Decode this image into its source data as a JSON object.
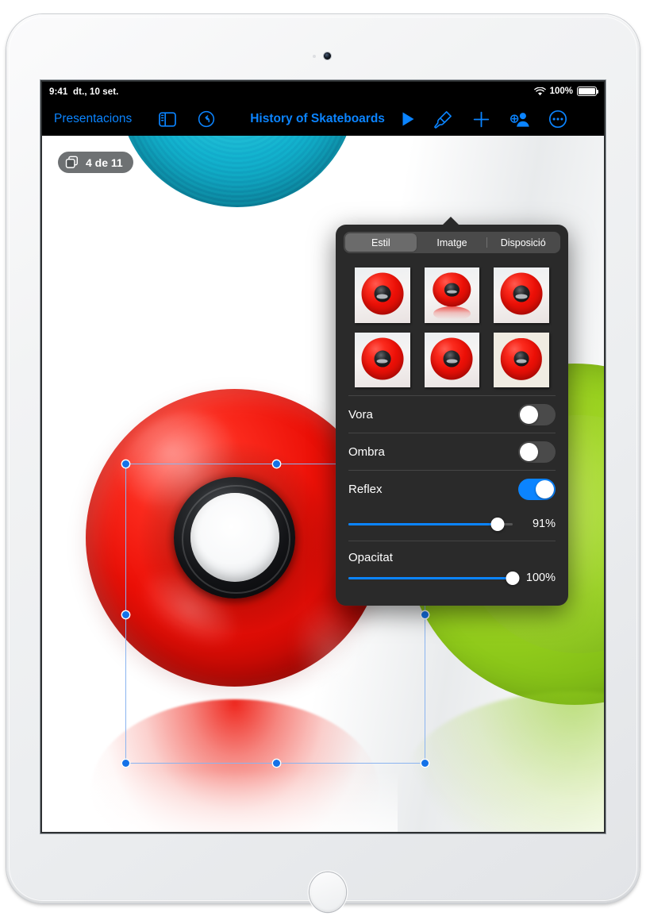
{
  "status_bar": {
    "time": "9:41",
    "date": "dt., 10 set.",
    "wifi_icon": "wifi-icon",
    "battery_percent": "100%",
    "battery_icon": "battery-full-icon"
  },
  "toolbar": {
    "back_label": "Presentacions",
    "sidebar_icon": "sidebar-icon",
    "undo_icon": "undo-icon",
    "document_title": "History of Skateboards",
    "play_icon": "play-icon",
    "format_brush_icon": "format-brush-icon",
    "add_icon": "plus-icon",
    "collaborate_icon": "add-person-icon",
    "more_icon": "more-ellipsis-icon"
  },
  "canvas": {
    "slide_pill": {
      "icon": "duplicate-slides-icon",
      "label": "4 de 11"
    },
    "selected_object": "red-skateboard-wheel-image"
  },
  "popover": {
    "tabs": [
      {
        "label": "Estil",
        "active": true
      },
      {
        "label": "Imatge",
        "active": false
      },
      {
        "label": "Disposició",
        "active": false
      }
    ],
    "styles": [
      {
        "name": "style-1",
        "variant": "plain",
        "selected": false
      },
      {
        "name": "style-2",
        "variant": "reflect",
        "selected": false
      },
      {
        "name": "style-3",
        "variant": "plain",
        "selected": false
      },
      {
        "name": "style-4",
        "variant": "plain",
        "selected": false
      },
      {
        "name": "style-5",
        "variant": "plain",
        "selected": false
      },
      {
        "name": "style-6",
        "variant": "framed",
        "selected": true
      }
    ],
    "border": {
      "label": "Vora",
      "enabled": false
    },
    "shadow": {
      "label": "Ombra",
      "enabled": false
    },
    "reflection": {
      "label": "Reflex",
      "enabled": true,
      "value": "91%",
      "percent": 91
    },
    "opacity": {
      "label": "Opacitat",
      "value": "100%",
      "percent": 100
    }
  },
  "colors": {
    "accent": "#0b84ff",
    "panel_bg": "#2a2a2a",
    "segment_bg": "#4a4a4a",
    "segment_active": "#6b6b6b",
    "switch_off": "#4a4a4a",
    "selection_handle": "#1572e8"
  }
}
